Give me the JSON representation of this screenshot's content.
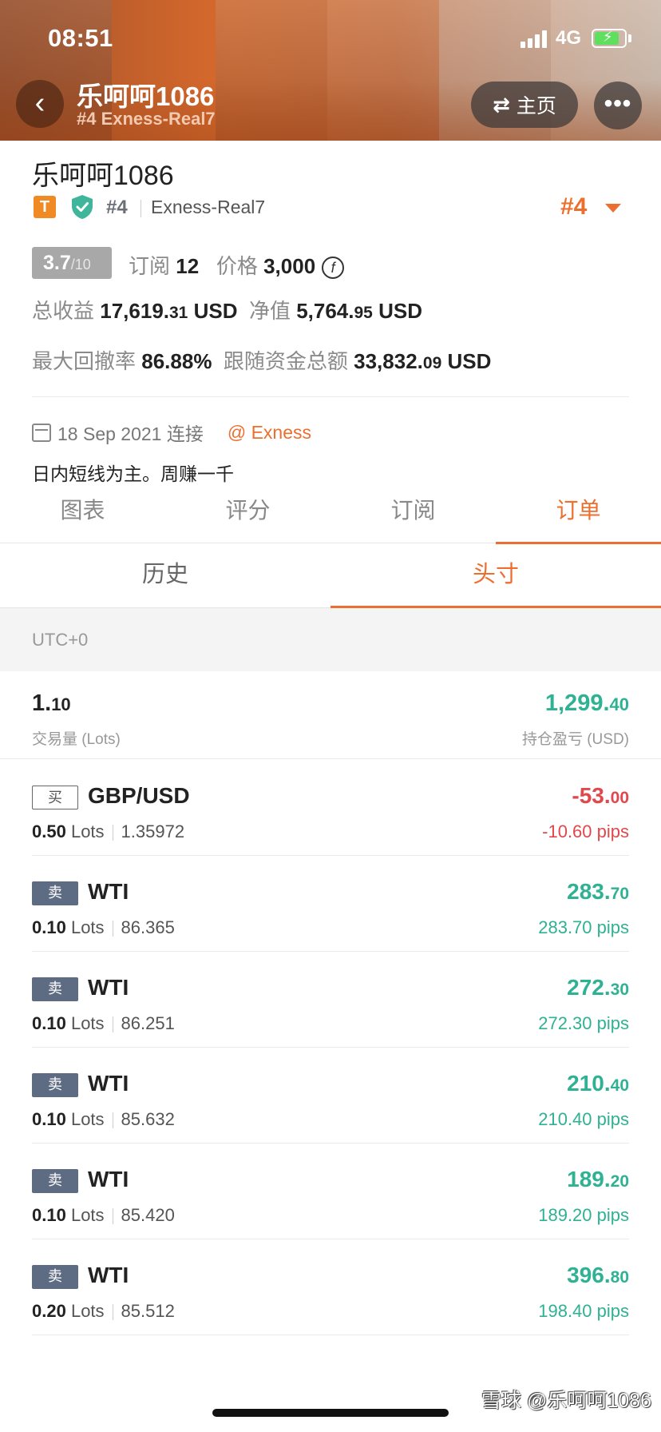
{
  "status_bar": {
    "time": "08:51",
    "network": "4G"
  },
  "nav": {
    "title": "乐呵呵1086",
    "subtitle": "#4 Exness-Real7",
    "home_label": "主页",
    "more_label": "•••"
  },
  "profile": {
    "name": "乐呵呵1086",
    "badge_letter": "T",
    "rank": "#4",
    "broker": "Exness-Real7",
    "rank_big": "#4",
    "score": "3.7",
    "score_max": "/10",
    "subscribe_label": "订阅",
    "subscribe_count": "12",
    "price_label": "价格",
    "price_value": "3,000",
    "coin_symbol": "f",
    "total_profit_label": "总收益",
    "total_profit_int": "17,619.",
    "total_profit_dec": "31",
    "currency": "USD",
    "equity_label": "净值",
    "equity_int": "5,764.",
    "equity_dec": "95",
    "max_drawdown_label": "最大回撤率",
    "max_drawdown": "86.88%",
    "follow_funds_label": "跟随资金总额",
    "follow_funds_int": "33,832.",
    "follow_funds_dec": "09",
    "connected_date": "18 Sep 2021 连接",
    "broker_link": "@ Exness",
    "bio": "日内短线为主。周赚一千"
  },
  "tabs": [
    "图表",
    "评分",
    "订阅",
    "订单"
  ],
  "active_tab": "订单",
  "subtabs": [
    "历史",
    "头寸"
  ],
  "active_subtab": "头寸",
  "timezone": "UTC+0",
  "summary": {
    "lots_int": "1.",
    "lots_dec": "10",
    "lots_label": "交易量 (Lots)",
    "pl_int": "1,299.",
    "pl_dec": "40",
    "pl_label": "持仓盈亏 (USD)"
  },
  "positions": [
    {
      "side": "买",
      "side_type": "buy",
      "symbol": "GBP/USD",
      "lots": "0.50",
      "lots_unit": "Lots",
      "price": "1.35972",
      "pl_int": "-53.",
      "pl_dec": "00",
      "pips": "-10.60 pips",
      "sign": "neg"
    },
    {
      "side": "卖",
      "side_type": "sell",
      "symbol": "WTI",
      "lots": "0.10",
      "lots_unit": "Lots",
      "price": "86.365",
      "pl_int": "283.",
      "pl_dec": "70",
      "pips": "283.70 pips",
      "sign": "pos"
    },
    {
      "side": "卖",
      "side_type": "sell",
      "symbol": "WTI",
      "lots": "0.10",
      "lots_unit": "Lots",
      "price": "86.251",
      "pl_int": "272.",
      "pl_dec": "30",
      "pips": "272.30 pips",
      "sign": "pos"
    },
    {
      "side": "卖",
      "side_type": "sell",
      "symbol": "WTI",
      "lots": "0.10",
      "lots_unit": "Lots",
      "price": "85.632",
      "pl_int": "210.",
      "pl_dec": "40",
      "pips": "210.40 pips",
      "sign": "pos"
    },
    {
      "side": "卖",
      "side_type": "sell",
      "symbol": "WTI",
      "lots": "0.10",
      "lots_unit": "Lots",
      "price": "85.420",
      "pl_int": "189.",
      "pl_dec": "20",
      "pips": "189.20 pips",
      "sign": "pos"
    },
    {
      "side": "卖",
      "side_type": "sell",
      "symbol": "WTI",
      "lots": "0.20",
      "lots_unit": "Lots",
      "price": "85.512",
      "pl_int": "396.",
      "pl_dec": "80",
      "pips": "198.40 pips",
      "sign": "pos"
    }
  ],
  "watermark": "雪球 @乐呵呵1086",
  "colors": {
    "accent": "#ec6f2f",
    "profit": "#2fb193",
    "loss": "#e0484c",
    "sell_badge": "#5d6b83"
  }
}
